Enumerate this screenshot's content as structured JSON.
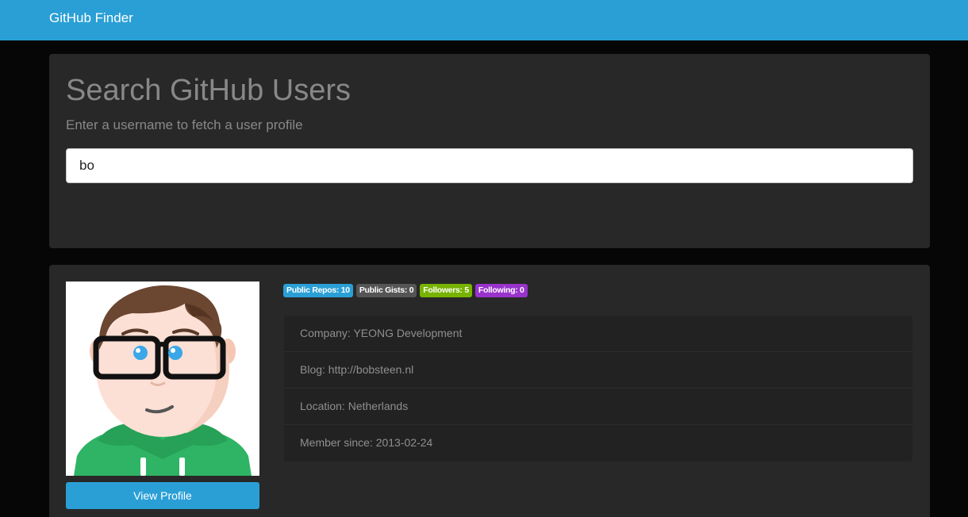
{
  "navbar": {
    "brand": "GitHub Finder",
    "color": "#2a9fd6"
  },
  "search": {
    "title": "Search GitHub Users",
    "subtitle": "Enter a username to fetch a user profile",
    "value": "bo",
    "placeholder": ""
  },
  "profile": {
    "avatar_icon": "cartoon-avatar-icon",
    "view_button_label": "View Profile",
    "badges": [
      {
        "label": "Public Repos: 10",
        "color": "#2a9fd6"
      },
      {
        "label": "Public Gists: 0",
        "color": "#555555"
      },
      {
        "label": "Followers: 5",
        "color": "#77b300"
      },
      {
        "label": "Following: 0",
        "color": "#9933cc"
      }
    ],
    "info": [
      "Company: YEONG Development",
      "Blog: http://bobsteen.nl",
      "Location: Netherlands",
      "Member since: 2013-02-24"
    ]
  }
}
